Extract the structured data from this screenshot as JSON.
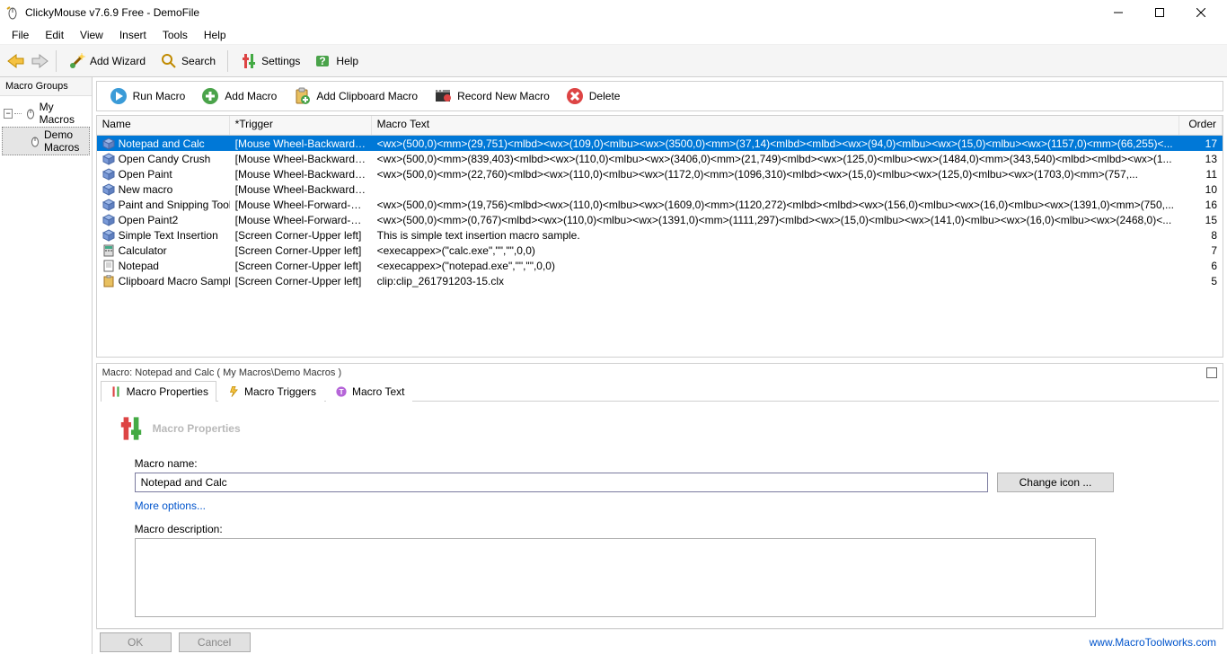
{
  "app": {
    "title": "ClickyMouse v7.6.9 Free - DemoFile"
  },
  "menu": {
    "items": [
      "File",
      "Edit",
      "View",
      "Insert",
      "Tools",
      "Help"
    ]
  },
  "toolbar": {
    "add_wizard": "Add Wizard",
    "search": "Search",
    "settings": "Settings",
    "help": "Help"
  },
  "sidebar": {
    "header": "Macro Groups",
    "root": "My Macros",
    "child": "Demo Macros"
  },
  "macro_toolbar": {
    "run": "Run Macro",
    "add": "Add Macro",
    "clipboard": "Add Clipboard Macro",
    "record": "Record New Macro",
    "delete": "Delete"
  },
  "grid": {
    "headers": {
      "name": "Name",
      "trigger": "*Trigger",
      "text": "Macro Text",
      "order": "Order"
    },
    "rows": [
      {
        "name": "Notepad and Calc",
        "trigger": "[Mouse Wheel-Backward-An...",
        "text": "<wx>(500,0)<mm>(29,751)<mlbd><wx>(109,0)<mlbu><wx>(3500,0)<mm>(37,14)<mlbd><mlbd><wx>(94,0)<mlbu><wx>(15,0)<mlbu><wx>(1157,0)<mm>(66,255)<...",
        "order": "17",
        "selected": true
      },
      {
        "name": "Open Candy Crush",
        "trigger": "[Mouse Wheel-Backward-An...",
        "text": "<wx>(500,0)<mm>(839,403)<mlbd><wx>(110,0)<mlbu><wx>(3406,0)<mm>(21,749)<mlbd><wx>(125,0)<mlbu><wx>(1484,0)<mm>(343,540)<mlbd><mlbd><wx>(1...",
        "order": "13"
      },
      {
        "name": "Open Paint",
        "trigger": "[Mouse Wheel-Backward-An...",
        "text": "<wx>(500,0)<mm>(22,760)<mlbd><wx>(110,0)<mlbu><wx>(1172,0)<mm>(1096,310)<mlbd><wx>(15,0)<mlbu><wx>(125,0)<mlbu><wx>(1703,0)<mm>(757,...",
        "order": "11"
      },
      {
        "name": "New macro",
        "trigger": "[Mouse Wheel-Backward-An...",
        "text": "",
        "order": "10"
      },
      {
        "name": "Paint and Snipping Tool",
        "trigger": "[Mouse Wheel-Forward-On T...",
        "text": "<wx>(500,0)<mm>(19,756)<mlbd><wx>(110,0)<mlbu><wx>(1609,0)<mm>(1120,272)<mlbd><mlbd><wx>(156,0)<mlbu><wx>(16,0)<mlbu><wx>(1391,0)<mm>(750,...",
        "order": "16"
      },
      {
        "name": "Open Paint2",
        "trigger": "[Mouse Wheel-Forward-On T...",
        "text": "<wx>(500,0)<mm>(0,767)<mlbd><wx>(110,0)<mlbu><wx>(1391,0)<mm>(1111,297)<mlbd><wx>(15,0)<mlbu><wx>(141,0)<mlbu><wx>(16,0)<mlbu><wx>(2468,0)<...",
        "order": "15"
      },
      {
        "name": "Simple Text Insertion",
        "trigger": "[Screen Corner-Upper left]",
        "text": "This is simple text insertion macro sample.",
        "order": "8"
      },
      {
        "name": "Calculator",
        "trigger": "[Screen Corner-Upper left]",
        "text": "<execappex>(\"calc.exe\",\"\",\"\",0,0)",
        "order": "7"
      },
      {
        "name": "Notepad",
        "trigger": "[Screen Corner-Upper left]",
        "text": "<execappex>(\"notepad.exe\",\"\",\"\",0,0)",
        "order": "6"
      },
      {
        "name": "Clipboard Macro Sample",
        "trigger": "[Screen Corner-Upper left]",
        "text": "clip:clip_261791203-15.clx",
        "order": "5"
      }
    ]
  },
  "props": {
    "caption": "Macro: Notepad and Calc ( My Macros\\Demo Macros )",
    "tabs": {
      "properties": "Macro Properties",
      "triggers": "Macro Triggers",
      "text": "Macro Text"
    },
    "heading": "Macro Properties",
    "name_label": "Macro name:",
    "name_value": "Notepad and Calc",
    "change_icon": "Change icon ...",
    "more_options": "More options...",
    "desc_label": "Macro description:"
  },
  "footer": {
    "ok": "OK",
    "cancel": "Cancel",
    "url": "www.MacroToolworks.com"
  }
}
